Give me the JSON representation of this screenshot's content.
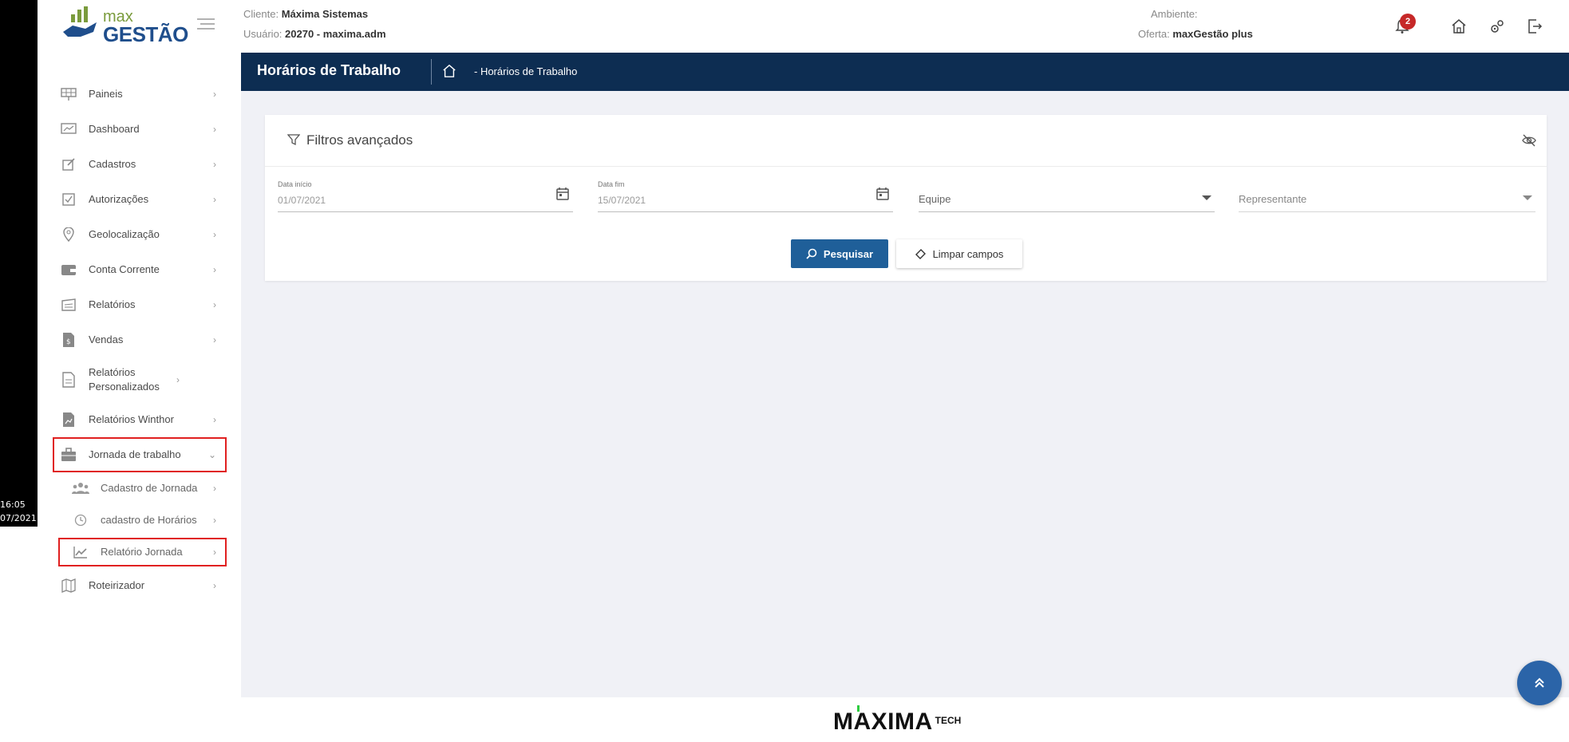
{
  "os": {
    "clock_time": "16:05",
    "clock_date": "07/2021"
  },
  "logo": {
    "line1": "max",
    "line2": "GESTÃO"
  },
  "header": {
    "client_label": "Cliente:",
    "client_value": "Máxima Sistemas",
    "user_label": "Usuário:",
    "user_value": "20270 - maxima.adm",
    "env_label": "Ambiente:",
    "offer_label": "Oferta:",
    "offer_value": "maxGestão plus",
    "notification_count": "2"
  },
  "sidebar": {
    "items": [
      {
        "label": "Paineis",
        "icon": "solar-panel-icon"
      },
      {
        "label": "Dashboard",
        "icon": "chart-board-icon"
      },
      {
        "label": "Cadastros",
        "icon": "edit-icon"
      },
      {
        "label": "Autorizações",
        "icon": "checkbox-icon"
      },
      {
        "label": "Geolocalização",
        "icon": "map-pin-icon"
      },
      {
        "label": "Conta Corrente",
        "icon": "wallet-icon"
      },
      {
        "label": "Relatórios",
        "icon": "report-icon"
      },
      {
        "label": "Vendas",
        "icon": "sales-doc-icon"
      },
      {
        "label": "Relatórios Personalizados",
        "icon": "document-icon"
      },
      {
        "label": "Relatórios Winthor",
        "icon": "chart-doc-icon"
      },
      {
        "label": "Jornada de trabalho",
        "icon": "briefcase-icon"
      },
      {
        "label": "Roteirizador",
        "icon": "map-icon"
      }
    ],
    "subitems": [
      {
        "label": "Cadastro de Jornada",
        "icon": "users-icon"
      },
      {
        "label": "cadastro de Horários",
        "icon": "clock-icon"
      },
      {
        "label": "Relatório Jornada",
        "icon": "trend-chart-icon"
      }
    ]
  },
  "page": {
    "title": "Horários de Trabalho",
    "breadcrumb": "- Horários de Trabalho"
  },
  "filters": {
    "title": "Filtros avançados",
    "date_start_label": "Data início",
    "date_start_value": "01/07/2021",
    "date_end_label": "Data fim",
    "date_end_value": "15/07/2021",
    "team_placeholder": "Equipe",
    "rep_placeholder": "Representante",
    "search_label": "Pesquisar",
    "clear_label": "Limpar campos"
  },
  "footer": {
    "brand": "MAXIMA",
    "brand_suffix": "TECH"
  },
  "colors": {
    "header_band": "#0d2d52",
    "primary_button": "#1f5f99",
    "highlight_box": "#e02020",
    "badge": "#c62828",
    "background": "#f0f1f6"
  }
}
